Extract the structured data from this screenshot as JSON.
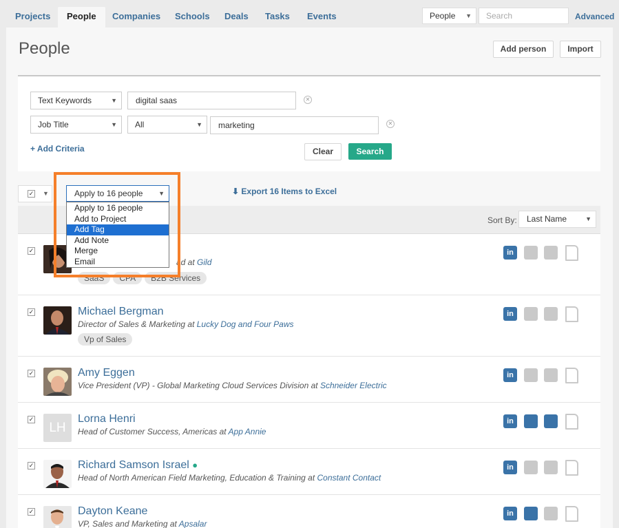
{
  "nav": {
    "tabs": [
      "Projects",
      "People",
      "Companies",
      "Schools",
      "Deals",
      "Tasks",
      "Events"
    ],
    "active_tab": "People",
    "search_scope": "People",
    "search_placeholder": "Search",
    "advanced_label": "Advanced"
  },
  "page": {
    "title": "People",
    "add_person_label": "Add person",
    "import_label": "Import"
  },
  "criteria": {
    "row1": {
      "field": "Text Keywords",
      "value": "digital saas"
    },
    "row2": {
      "field": "Job Title",
      "operator": "All",
      "value": "marketing"
    },
    "add_label": "+ Add Criteria",
    "clear_label": "Clear",
    "search_label": "Search"
  },
  "bulk": {
    "apply_label": "Apply to 16 people",
    "options": [
      "Apply to 16 people",
      "Add to Project",
      "Add Tag",
      "Add Note",
      "Merge",
      "Email"
    ],
    "highlighted_option": "Add Tag",
    "export_label": "Export 16 Items to Excel"
  },
  "sort": {
    "label": "Sort By:",
    "value": "Last Name"
  },
  "people": [
    {
      "name": "",
      "title_partial": "ad at",
      "company": "Gild",
      "tags": [
        "SaaS",
        "CPA",
        "B2B Services"
      ],
      "checked": true,
      "email": false,
      "phone": false
    },
    {
      "name": "Michael Bergman",
      "title": "Director of Sales & Marketing at",
      "company": "Lucky Dog and Four Paws",
      "tags": [
        "Vp of Sales"
      ],
      "checked": true,
      "email": false,
      "phone": false
    },
    {
      "name": "Amy Eggen",
      "title": "Vice President (VP) - Global Marketing Cloud Services Division at",
      "company": "Schneider Electric",
      "tags": [],
      "checked": true,
      "email": false,
      "phone": false
    },
    {
      "name": "Lorna Henri",
      "initials": "LH",
      "title": "Head of Customer Success, Americas at",
      "company": "App Annie",
      "tags": [],
      "checked": true,
      "email": true,
      "phone": true
    },
    {
      "name": "Richard Samson Israel",
      "title": "Head of North American Field Marketing, Education & Training at",
      "company": "Constant Contact",
      "tags": [],
      "checked": true,
      "email": false,
      "phone": false
    },
    {
      "name": "Dayton Keane",
      "title": "VP, Sales and Marketing at",
      "company": "Apsalar",
      "tags": [],
      "checked": true,
      "email": true,
      "phone": false
    }
  ],
  "colors": {
    "link": "#3c6e99",
    "accent_green": "#26a889",
    "highlight_orange": "#f57f2a",
    "selection_blue": "#1e6fd1"
  }
}
